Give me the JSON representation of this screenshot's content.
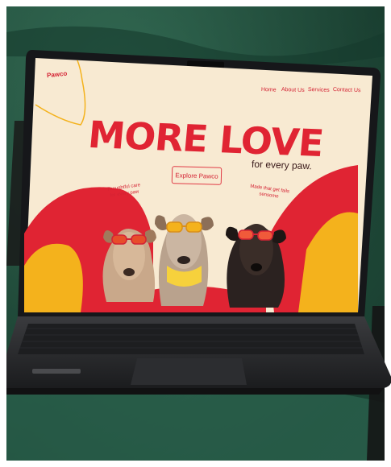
{
  "brand": {
    "logo_text": "Pawco"
  },
  "nav": {
    "items": [
      "Home",
      "About Us",
      "Services",
      "Contact Us"
    ]
  },
  "hero": {
    "headline": "MORE LOVE",
    "subheadline": "for every paw.",
    "cta_label": "Explore Pawco",
    "quote_left": "Thoughtful care for every paw",
    "quote_right": "Made that get fails sensome"
  },
  "colors": {
    "accent_red": "#e02433",
    "accent_yellow": "#f4b21c",
    "cream": "#f8ead2",
    "velvet_green": "#1f4a3a",
    "laptop_dark": "#2a2b2e"
  }
}
